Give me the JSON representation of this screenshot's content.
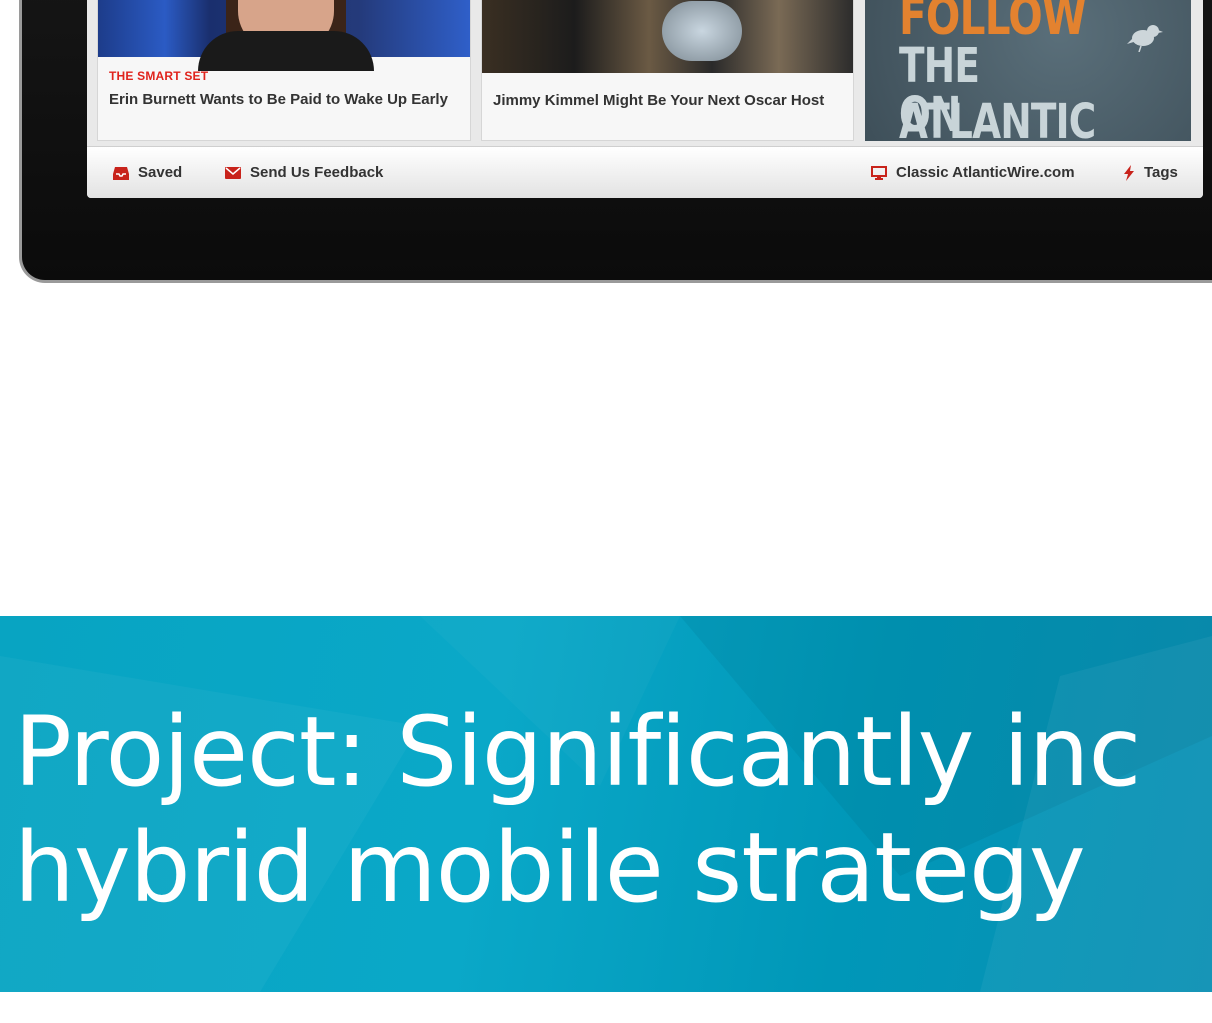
{
  "cards": [
    {
      "label": "THE SMART SET",
      "title": "Erin Burnett Wants to Be Paid to Wake Up Early"
    },
    {
      "label": "",
      "title": "Jimmy Kimmel Might Be Your Next Oscar Host"
    }
  ],
  "promo": {
    "line1": "FOLLOW",
    "line2": "THE ATLANTIC",
    "line3": "ON TWITTER",
    "icon": "bird-icon"
  },
  "footer": {
    "saved": "Saved",
    "feedback": "Send Us Feedback",
    "classic": "Classic AtlanticWire.com",
    "tags": "Tags"
  },
  "banner": {
    "line1": "Project: Significantly inc",
    "line2": "hybrid mobile strategy"
  },
  "colors": {
    "accent_red": "#e0231c",
    "promo_orange": "#e3822f",
    "banner_blue": "#0aa8c8"
  }
}
